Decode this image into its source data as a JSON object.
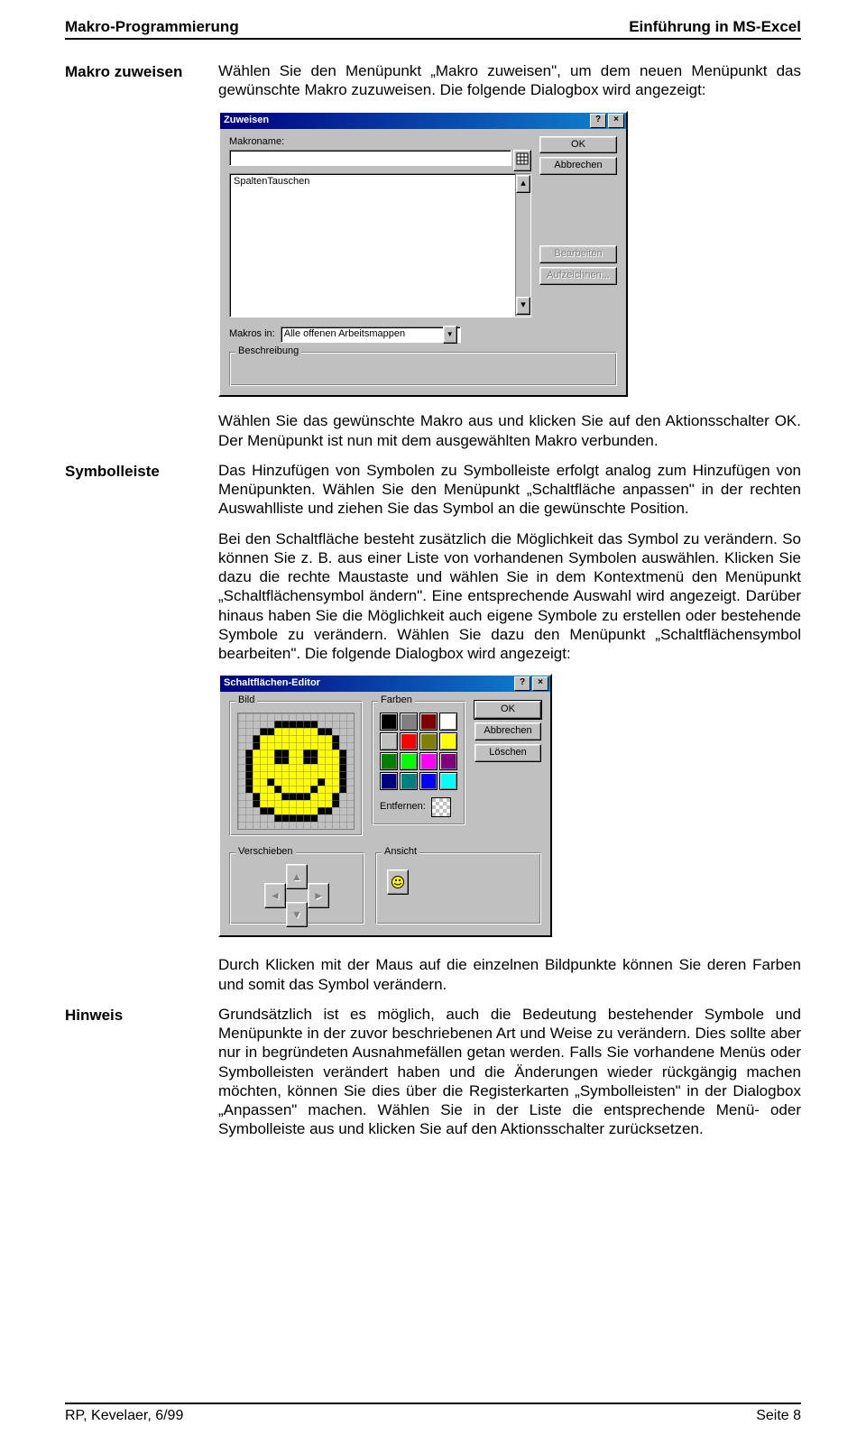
{
  "header": {
    "left": "Makro-Programmierung",
    "right": "Einführung in MS-Excel"
  },
  "footer": {
    "left": "RP, Kevelaer, 6/99",
    "right": "Seite 8"
  },
  "sections": {
    "s1": {
      "label": "Makro zuweisen",
      "p1": "Wählen Sie den Menüpunkt „Makro zuweisen\", um dem neuen Menüpunkt das gewünschte Makro zuzuweisen. Die folgende Dialogbox wird angezeigt:"
    },
    "s2": {
      "p1": "Wählen Sie das gewünschte Makro aus und klicken Sie auf den Aktionsschalter OK. Der Menüpunkt ist nun mit dem ausgewählten Makro verbunden."
    },
    "s3": {
      "label": "Symbolleiste",
      "p1": "Das Hinzufügen von Symbolen zu Symbolleiste erfolgt analog zum Hinzufügen von Menüpunkten. Wählen Sie den Menüpunkt „Schaltfläche anpassen\" in der rechten Auswahlliste und ziehen Sie das Symbol an die gewünschte Position.",
      "p2": "Bei den Schaltfläche besteht zusätzlich die Möglichkeit das Symbol zu verändern. So können Sie z. B. aus einer Liste von vorhandenen Symbolen auswählen. Klicken Sie dazu die rechte Maustaste und wählen Sie in dem Kontextmenü den Menüpunkt „Schaltflächensymbol ändern\". Eine entsprechende Auswahl wird angezeigt. Darüber hinaus haben Sie die Möglichkeit auch eigene Symbole zu erstellen oder bestehende Symbole zu verändern. Wählen Sie dazu den Menüpunkt „Schaltflächensymbol bearbeiten\". Die folgende Dialogbox wird angezeigt:"
    },
    "s4": {
      "p1": "Durch Klicken mit der Maus auf die einzelnen Bildpunkte können Sie deren Farben und somit das Symbol verändern."
    },
    "s5": {
      "label": "Hinweis",
      "p1": "Grundsätzlich ist es möglich, auch die Bedeutung bestehender Symbole und Menüpunkte in der zuvor beschriebenen Art und Weise zu verändern. Dies sollte aber nur in begründeten Ausnahmefällen getan werden. Falls Sie vorhandene Menüs oder Symbolleisten verändert haben und die Änderungen wieder rückgängig machen möchten, können Sie dies über die Registerkarten „Symbolleisten\" in der Dialogbox „Anpassen\" machen. Wählen Sie in der Liste die entsprechende Menü- oder Symbolleiste aus und klicken Sie auf den Aktionsschalter zurücksetzen."
    }
  },
  "dlg_assign": {
    "title": "Zuweisen",
    "lbl_name": "Makroname:",
    "list_item": "SpaltenTauschen",
    "btn_ok": "OK",
    "btn_cancel": "Abbrechen",
    "btn_edit": "Bearbeiten",
    "btn_record": "Aufzeichnen...",
    "lbl_in": "Makros in:",
    "val_in": "Alle offenen Arbeitsmappen",
    "lbl_desc": "Beschreibung"
  },
  "dlg_editor": {
    "title": "Schaltflächen-Editor",
    "grp_bild": "Bild",
    "grp_farben": "Farben",
    "btn_ok": "OK",
    "btn_cancel": "Abbrechen",
    "btn_clear": "Löschen",
    "lbl_entf": "Entfernen:",
    "grp_move": "Verschieben",
    "grp_view": "Ansicht",
    "palette": [
      "#000000",
      "#808080",
      "#800000",
      "#ffffff",
      "#c0c0c0",
      "#ff0000",
      "#808000",
      "#ffff00",
      "#008000",
      "#00ff00",
      "#ff00ff",
      "#800080",
      "#000080",
      "#008080",
      "#0000ff",
      "#00ffff"
    ]
  }
}
